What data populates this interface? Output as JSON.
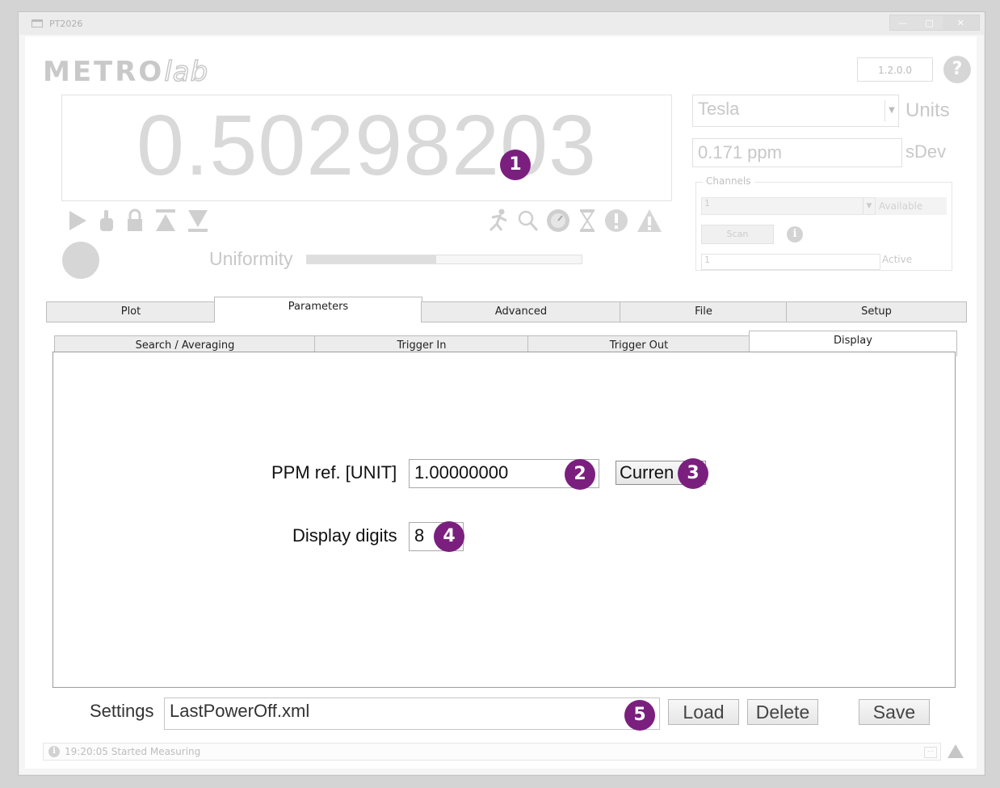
{
  "window": {
    "title": "PT2026",
    "controls": [
      "—",
      "□",
      "✕"
    ]
  },
  "header": {
    "logo_main": "METRO",
    "logo_sub": "lab",
    "version": "1.2.0.0",
    "help_symbol": "?"
  },
  "measurement": {
    "value": "0.50298203",
    "uniformity_label": "Uniformity",
    "uniformity_level": 0.47
  },
  "units": {
    "selected": "Tesla",
    "label": "Units",
    "sdev_value": "0.171 ppm",
    "sdev_label": "sDev"
  },
  "channels": {
    "legend": "Channels",
    "selected": "1",
    "available_label": "Available",
    "scan_label": "Scan",
    "active_value": "1",
    "active_label": "Active"
  },
  "control_icons": [
    "play-icon",
    "touch-icon",
    "lock-icon",
    "top-icon",
    "bottom-icon"
  ],
  "status_icons": [
    "running-icon",
    "search-icon",
    "gauge-icon",
    "hourglass-icon",
    "error-icon",
    "warning-icon"
  ],
  "tabs": [
    {
      "label": "Plot"
    },
    {
      "label": "Parameters"
    },
    {
      "label": "Advanced"
    },
    {
      "label": "File"
    },
    {
      "label": "Setup"
    }
  ],
  "subtabs": [
    {
      "label": "Search / Averaging"
    },
    {
      "label": "Trigger In"
    },
    {
      "label": "Trigger Out"
    },
    {
      "label": "Display"
    }
  ],
  "display_panel": {
    "ppm_label": "PPM ref. [UNIT]",
    "ppm_value": "1.00000000",
    "current_button": "Curren",
    "digits_label": "Display digits",
    "digits_value": "8"
  },
  "settings": {
    "label": "Settings",
    "value": "LastPowerOff.xml",
    "load": "Load",
    "delete": "Delete",
    "save": "Save"
  },
  "statusbar": {
    "message": "19:20:05 Started Measuring",
    "info_symbol": "i"
  },
  "markers": [
    "1",
    "2",
    "3",
    "4",
    "5"
  ],
  "colors": {
    "marker": "#7b1f7f",
    "faded": "#d9d9d9"
  }
}
